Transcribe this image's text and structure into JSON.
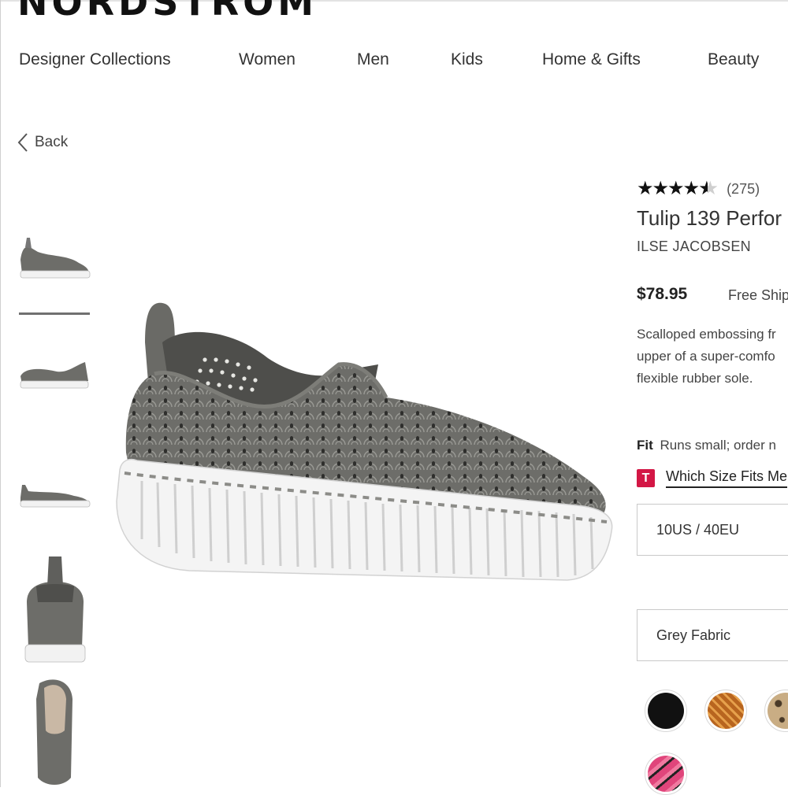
{
  "brand_logo": "NORDSTROM",
  "nav": {
    "items": [
      "Designer Collections",
      "Women",
      "Men",
      "Kids",
      "Home & Gifts",
      "Beauty"
    ]
  },
  "back": {
    "label": "Back"
  },
  "gallery": {
    "thumbnail_count": 6,
    "selected_index": 1
  },
  "product": {
    "rating": 4.5,
    "review_count": "(275)",
    "title": "Tulip 139 Perfor",
    "brand": "ILSE JACOBSEN",
    "price": "$78.95",
    "shipping": "Free Ship",
    "description_lines": [
      "Scalloped embossing fr",
      "upper of a super-comfo",
      "flexible rubber sole."
    ],
    "fit_label": "Fit",
    "fit_text": "Runs small; order n",
    "size_guide_badge": "T",
    "size_guide_link": "Which Size Fits Me",
    "selected_size": "10US / 40EU",
    "selected_color": "Grey Fabric"
  },
  "swatches": [
    {
      "name": "black",
      "color": "#111111"
    },
    {
      "name": "brown-pattern",
      "color": "#b8651f"
    },
    {
      "name": "leopard",
      "color": "#c9ad84"
    },
    {
      "name": "pink-stripe",
      "color": "#e0457b"
    }
  ],
  "colors": {
    "accent_red": "#d31745",
    "text_dark": "#222222",
    "shoe_grey": "#6d6d69",
    "sole_white": "#f4f4f4"
  }
}
